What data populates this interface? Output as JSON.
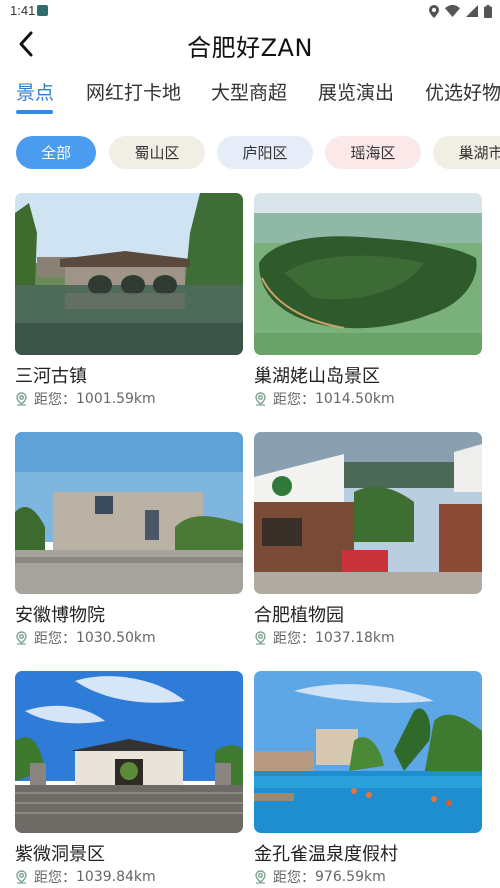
{
  "status": {
    "time": "1:41",
    "icons": [
      "location-icon",
      "wifi-icon",
      "signal-icon",
      "battery-icon"
    ]
  },
  "header": {
    "title": "合肥好ZAN",
    "back_icon": "chevron-left-icon"
  },
  "tabs": [
    {
      "label": "景点",
      "active": true
    },
    {
      "label": "网红打卡地",
      "active": false
    },
    {
      "label": "大型商超",
      "active": false
    },
    {
      "label": "展览演出",
      "active": false
    },
    {
      "label": "优选好物",
      "active": false
    }
  ],
  "filters": [
    {
      "label": "全部",
      "selected": true,
      "bg": "#4a9cf0",
      "fg": "#ffffff"
    },
    {
      "label": "蜀山区",
      "selected": false,
      "bg": "#f1efe4",
      "fg": "#333333"
    },
    {
      "label": "庐阳区",
      "selected": false,
      "bg": "#e6edf8",
      "fg": "#333333"
    },
    {
      "label": "瑶海区",
      "selected": false,
      "bg": "#fbe9ea",
      "fg": "#333333"
    },
    {
      "label": "巢湖市",
      "selected": false,
      "bg": "#f1efe4",
      "fg": "#333333"
    }
  ],
  "distance_prefix": "距您：",
  "cards": [
    {
      "title": "三河古镇",
      "distance": "1001.59km",
      "image": "ancient town stone bridge"
    },
    {
      "title": "巢湖姥山岛景区",
      "distance": "1014.50km",
      "image": "island in lake aerial"
    },
    {
      "title": "安徽博物院",
      "distance": "1030.50km",
      "image": "museum building"
    },
    {
      "title": "合肥植物园",
      "distance": "1037.18km",
      "image": "botanical garden gate"
    },
    {
      "title": "紫微洞景区",
      "distance": "1039.84km",
      "image": "traditional gate building"
    },
    {
      "title": "金孔雀温泉度假村",
      "distance": "976.59km",
      "image": "hot spring pool resort"
    }
  ],
  "colors": {
    "accent": "#2e8ae6",
    "active_tab": "#2e7fcf"
  }
}
